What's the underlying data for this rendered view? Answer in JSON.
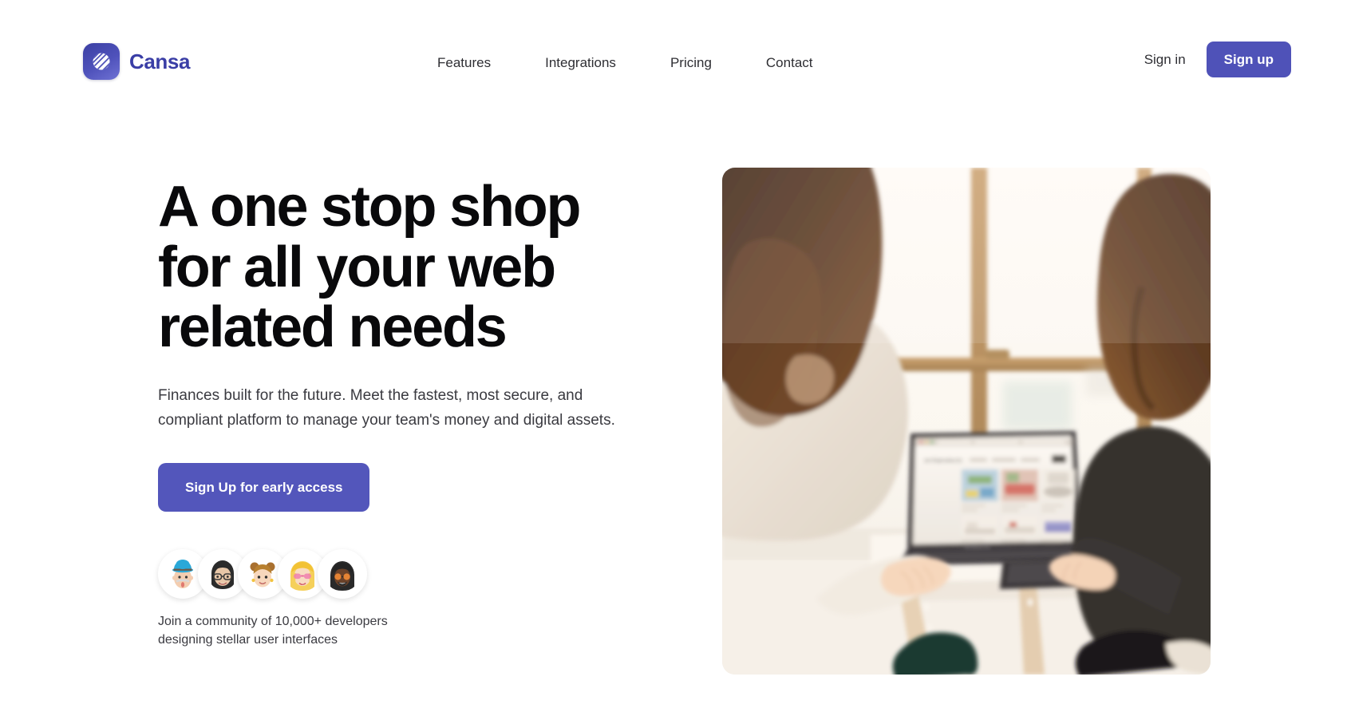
{
  "brand": {
    "name": "Cansa",
    "logo_icon": "striped-circle-logo-icon",
    "accent_color": "#4f52b8",
    "wordmark_color": "#3a3ea6"
  },
  "header": {
    "nav": [
      {
        "label": "Features"
      },
      {
        "label": "Integrations"
      },
      {
        "label": "Pricing"
      },
      {
        "label": "Contact"
      }
    ],
    "signin_label": "Sign in",
    "signup_label": "Sign up"
  },
  "hero": {
    "headline": "A one stop shop\nfor all your web\nrelated needs",
    "subhead": "Finances built for the future. Meet the fastest, most secure, and compliant platform to manage your team's money and digital assets.",
    "cta_label": "Sign Up for early access",
    "community_note": "Join a community of 10,000+ developers\ndesigning stellar user interfaces",
    "avatars": [
      {
        "name": "avatar-man-blue-hat"
      },
      {
        "name": "avatar-woman-glasses"
      },
      {
        "name": "avatar-girl-buns"
      },
      {
        "name": "avatar-blonde-pink-sunglasses"
      },
      {
        "name": "avatar-person-orange-sunglasses"
      }
    ],
    "image_alt": "Two women seated at a white table by a bright window, one typing on a laptop showing a furniture shopping website"
  }
}
